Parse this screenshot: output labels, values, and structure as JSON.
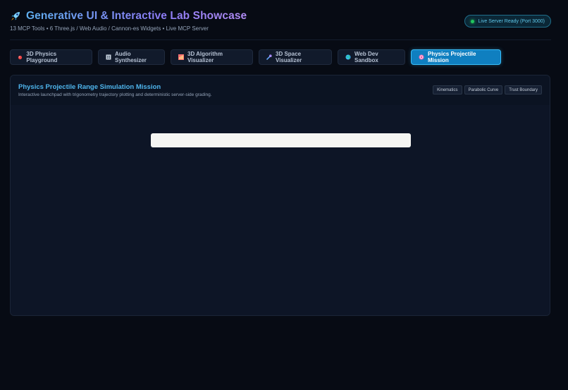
{
  "header": {
    "title": "Generative UI & Interactive Lab Showcase",
    "subtitle": "13 MCP Tools • 6 Three.js / Web Audio / Cannon-es Widgets • Live MCP Server",
    "status": "Live Server Ready (Port 3000)",
    "icon": "rocket-icon"
  },
  "tabs": [
    {
      "label": "3D Physics Playground",
      "icon": "red-dot-icon",
      "active": false
    },
    {
      "label": "Audio Synthesizer",
      "icon": "grid-icon",
      "active": false
    },
    {
      "label": "3D Algorithm Visualizer",
      "icon": "bar-chart-icon",
      "active": false
    },
    {
      "label": "3D Space Visualizer",
      "icon": "comet-icon",
      "active": false
    },
    {
      "label": "Web Dev Sandbox",
      "icon": "globe-icon",
      "active": false
    },
    {
      "label": "Physics Projectile Mission",
      "icon": "target-icon",
      "active": true
    }
  ],
  "panel": {
    "title": "Physics Projectile Range Simulation Mission",
    "description": "Interactive launchpad with trigonometry trajectory plotting and deterministic server-side grading.",
    "tags": [
      "Kinematics",
      "Parabolic Curve",
      "Trust Boundary"
    ]
  },
  "colors": {
    "accent": "#0f7fc0",
    "title_gradient_start": "#5fb0f0",
    "title_gradient_end": "#b18cf5",
    "status_dot": "#22c55e"
  }
}
